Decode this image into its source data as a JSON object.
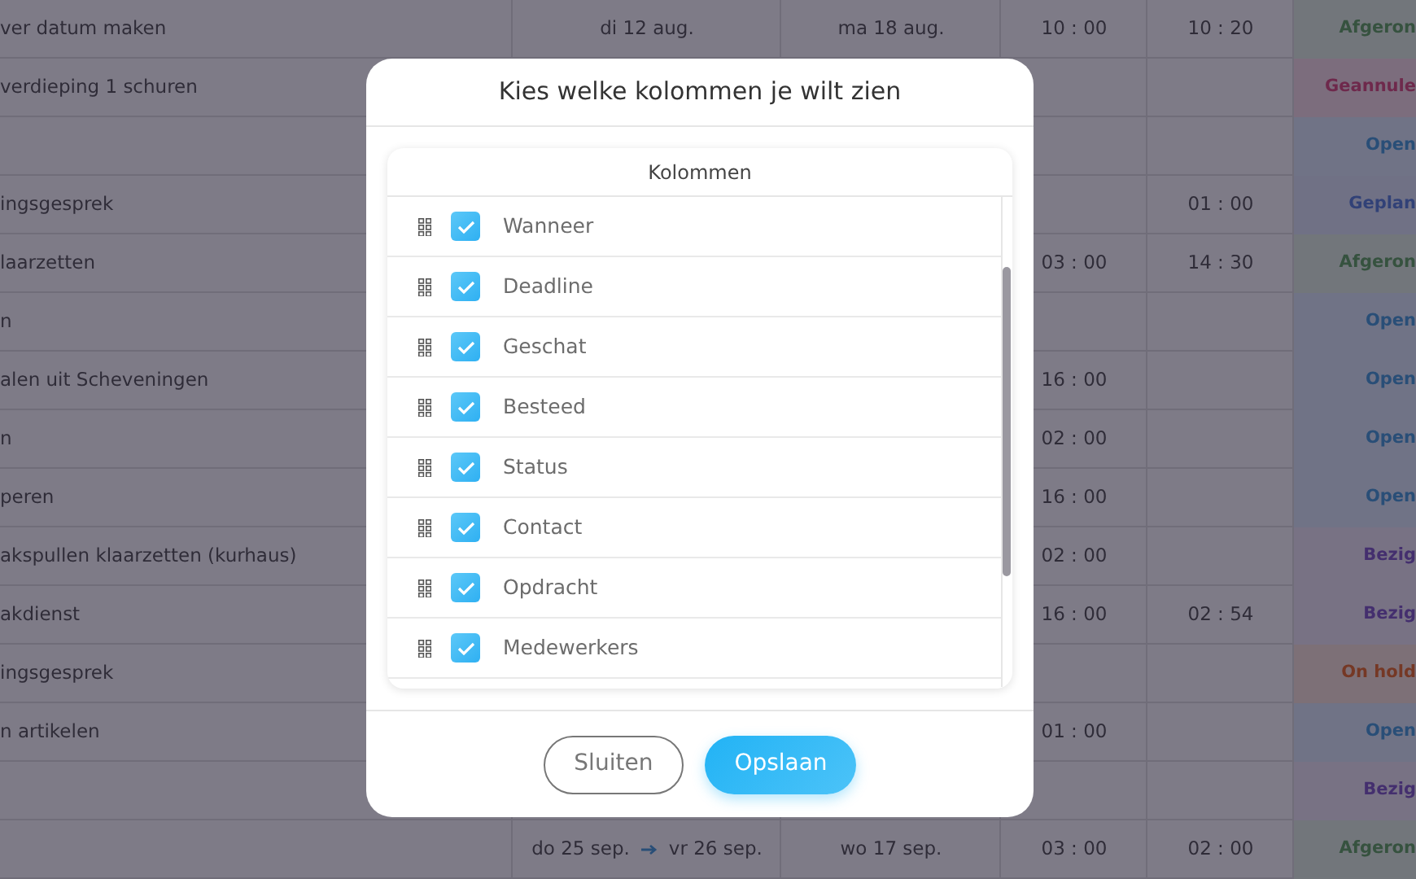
{
  "table": {
    "rows": [
      {
        "task": "ver datum maken",
        "start": "di 12 aug.",
        "deadline": "ma 18 aug.",
        "estimated": "10 : 00",
        "spent": "10 : 20",
        "status": {
          "label": "Afgeron",
          "kind": "done"
        }
      },
      {
        "task": "verdieping 1 schuren",
        "status": {
          "label": "Geannule",
          "kind": "cancelled"
        }
      },
      {
        "status": {
          "label": "Open",
          "kind": "open"
        }
      },
      {
        "task": "ingsgesprek",
        "spent": "01 : 00",
        "status": {
          "label": "Geplan",
          "kind": "planned"
        }
      },
      {
        "task": "laarzetten",
        "estimated": "03 : 00",
        "spent": "14 : 30",
        "status": {
          "label": "Afgeron",
          "kind": "done"
        }
      },
      {
        "task": "n",
        "status": {
          "label": "Open",
          "kind": "open"
        }
      },
      {
        "task": "alen uit Scheveningen",
        "estimated": "16 : 00",
        "status": {
          "label": "Open",
          "kind": "open"
        }
      },
      {
        "task": "n",
        "estimated": "02 : 00",
        "status": {
          "label": "Open",
          "kind": "open"
        }
      },
      {
        "task": "peren",
        "estimated": "16 : 00",
        "status": {
          "label": "Open",
          "kind": "open"
        }
      },
      {
        "task": "akspullen klaarzetten (kurhaus)",
        "estimated": "02 : 00",
        "status": {
          "label": "Bezig",
          "kind": "busy"
        }
      },
      {
        "task": "akdienst",
        "estimated": "16 : 00",
        "spent": "02 : 54",
        "status": {
          "label": "Bezig",
          "kind": "busy"
        }
      },
      {
        "task": "ingsgesprek",
        "status": {
          "label": "On hold",
          "kind": "onhold"
        }
      },
      {
        "task": "n artikelen",
        "estimated": "01 : 00",
        "status": {
          "label": "Open",
          "kind": "open"
        }
      },
      {
        "status": {
          "label": "Bezig",
          "kind": "busy"
        }
      },
      {
        "start": "do 25 sep.",
        "end": "vr 26 sep.",
        "deadline": "wo 17 sep.",
        "estimated": "03 : 00",
        "spent": "02 : 00",
        "status": {
          "label": "Afgeron",
          "kind": "done"
        }
      }
    ]
  },
  "modal": {
    "title": "Kies welke kolommen je wilt zien",
    "list_title": "Kolommen",
    "columns": [
      {
        "label": "Wanneer",
        "checked": true
      },
      {
        "label": "Deadline",
        "checked": true
      },
      {
        "label": "Geschat",
        "checked": true
      },
      {
        "label": "Besteed",
        "checked": true
      },
      {
        "label": "Status",
        "checked": true
      },
      {
        "label": "Contact",
        "checked": true
      },
      {
        "label": "Opdracht",
        "checked": true
      },
      {
        "label": "Medewerkers",
        "checked": true
      }
    ],
    "buttons": [
      {
        "label": "Sluiten",
        "kind": "secondary"
      },
      {
        "label": "Opslaan",
        "kind": "primary"
      }
    ]
  }
}
